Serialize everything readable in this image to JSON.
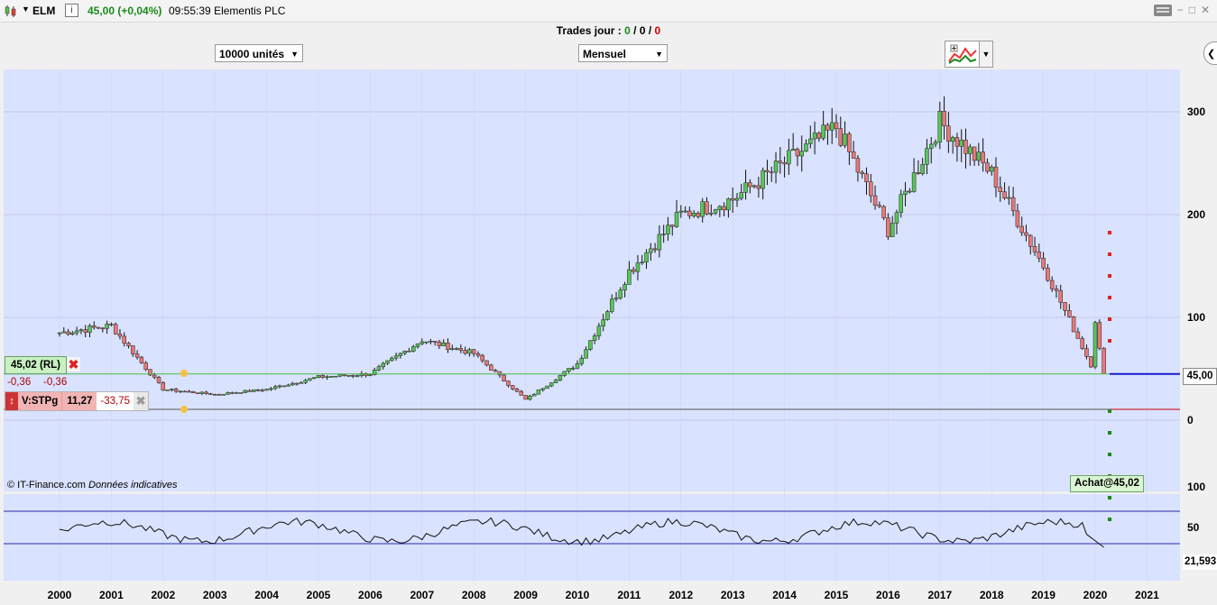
{
  "window": {
    "symbol": "ELM",
    "price_change": "45,00 (+0,04%)",
    "time": "09:55:39",
    "instrument_name": "Elementis PLC",
    "info_label": "i",
    "controls": [
      "−",
      "□",
      "✕"
    ]
  },
  "trades_bar": {
    "label": "Trades jour :",
    "count_green": "0",
    "count_neutral": "0",
    "count_red": "0",
    "separator": " / "
  },
  "toolbar": {
    "quantity_select": "10000 unités",
    "period_select": "Mensuel",
    "side_arrow": "❮"
  },
  "price_chart": {
    "y_labels": [
      "300",
      "200",
      "100",
      "0"
    ],
    "current_price_label": "45,00",
    "last_close": 45.0,
    "credit_source": "© IT-Finance.com",
    "credit_note": "Données indicatives"
  },
  "position_panel": {
    "price_label": "45,02 (RL)",
    "close_symbol": "✖",
    "diff_a": "-0,36",
    "diff_b": "-0,36",
    "order_icon": "↕",
    "order_label": "V:STPg",
    "order_value": "11,27",
    "order_pnl": "-33,75",
    "order_close": "✖"
  },
  "achat_label": "Achat@45,02",
  "rsi_chart": {
    "y_labels": [
      "100",
      "50"
    ],
    "current_value_label": "21,593"
  },
  "x_axis_years": [
    "2000",
    "2001",
    "2002",
    "2003",
    "2004",
    "2005",
    "2006",
    "2007",
    "2008",
    "2009",
    "2010",
    "2011",
    "2012",
    "2013",
    "2014",
    "2015",
    "2016",
    "2017",
    "2018",
    "2019",
    "2020",
    "2021"
  ],
  "colors": {
    "chart_bg": "#d9e2ff",
    "up_candle": "#58c558",
    "down_candle": "#e87878",
    "price_line": "#1a1acc",
    "price_positive": "#1a8a1a",
    "negative": "#cc0000"
  },
  "chart_data": {
    "type": "candlestick",
    "interval": "monthly",
    "closes_by_year": {
      "years": [
        2000,
        2001,
        2002,
        2003,
        2004,
        2005,
        2006,
        2007,
        2008,
        2009,
        2010,
        2011,
        2012,
        2013,
        2014,
        2015,
        2016,
        2017,
        2018,
        2019,
        2020
      ],
      "values": [
        85,
        92,
        30,
        25,
        30,
        42,
        45,
        78,
        65,
        20,
        55,
        145,
        200,
        215,
        250,
        285,
        185,
        290,
        240,
        150,
        45
      ]
    },
    "rsi": {
      "overbought": 70,
      "oversold": 30,
      "last": 21.593
    }
  }
}
